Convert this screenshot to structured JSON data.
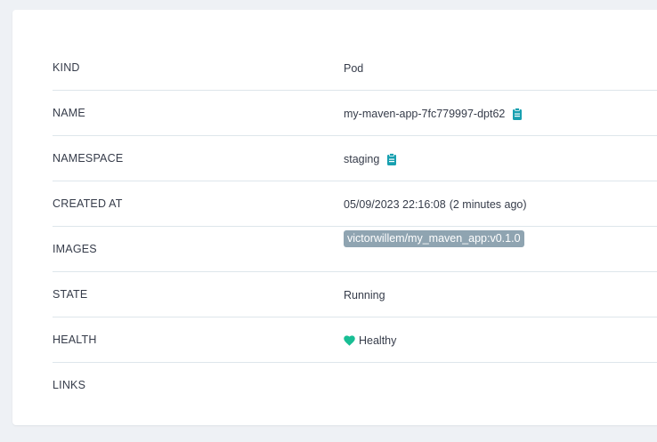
{
  "colors": {
    "accent": "#18a0b0",
    "healthy": "#18be94",
    "tag_bg": "#8fa4b1",
    "divider": "#dee6eb"
  },
  "rows": {
    "kind": {
      "label": "KIND",
      "value": "Pod"
    },
    "name": {
      "label": "NAME",
      "value": "my-maven-app-7fc779997-dpt62",
      "icon": "clipboard-icon"
    },
    "namespace": {
      "label": "NAMESPACE",
      "value": "staging",
      "icon": "clipboard-icon"
    },
    "created_at": {
      "label": "CREATED AT",
      "value": "05/09/2023 22:16:08",
      "relative": "(2 minutes ago)"
    },
    "images": {
      "label": "IMAGES",
      "value": "victorwillem/my_maven_app:v0.1.0"
    },
    "state": {
      "label": "STATE",
      "value": "Running"
    },
    "health": {
      "label": "HEALTH",
      "value": "Healthy",
      "icon": "heart-icon"
    },
    "links": {
      "label": "LINKS",
      "value": ""
    }
  }
}
